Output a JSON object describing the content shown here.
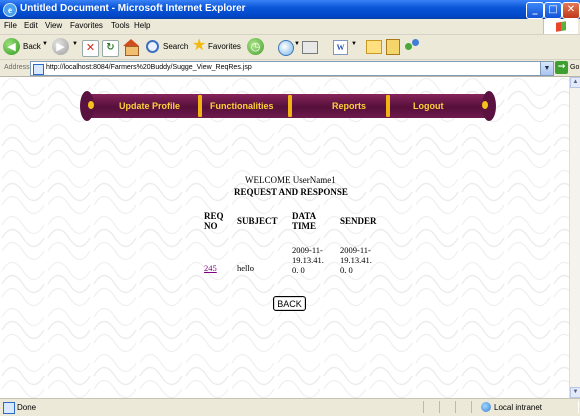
{
  "window": {
    "title": "Untitled Document - Microsoft Internet Explorer",
    "buttons": [
      "_",
      "□",
      "✕"
    ]
  },
  "menu": [
    "File",
    "Edit",
    "View",
    "Favorites",
    "Tools",
    "Help"
  ],
  "toolbar": {
    "back_label": "Back",
    "search_label": "Search",
    "favorites_label": "Favorites"
  },
  "address": {
    "label": "Address",
    "url": "http://localhost:8084/Farmers%20Buddy/Sugge_View_ReqRes.jsp",
    "go_label": "Go"
  },
  "nav": {
    "items": [
      "Update Profile",
      "Functionalities",
      "Reports",
      "Logout"
    ],
    "colors": {
      "bar": "#6e1a4d",
      "text": "#ffd03a",
      "separator": "#f1b414"
    }
  },
  "page": {
    "welcome": "WELCOME UserName1",
    "section_title": "REQUEST AND RESPONSE",
    "table": {
      "headers": [
        [
          "REQ",
          "NO"
        ],
        [
          "SUBJECT"
        ],
        [
          "DATA",
          "TIME"
        ],
        [
          "SENDER"
        ]
      ],
      "rows": [
        {
          "req_no": "245",
          "subject": "hello",
          "data_time": [
            "2009-11-",
            "19.13.41.",
            "0. 0"
          ],
          "sender": [
            "2009-11-",
            "19.13.41.",
            "0. 0"
          ]
        }
      ]
    },
    "back_button": "BACK"
  },
  "status": {
    "text": "Done",
    "zone": "Local intranet"
  }
}
